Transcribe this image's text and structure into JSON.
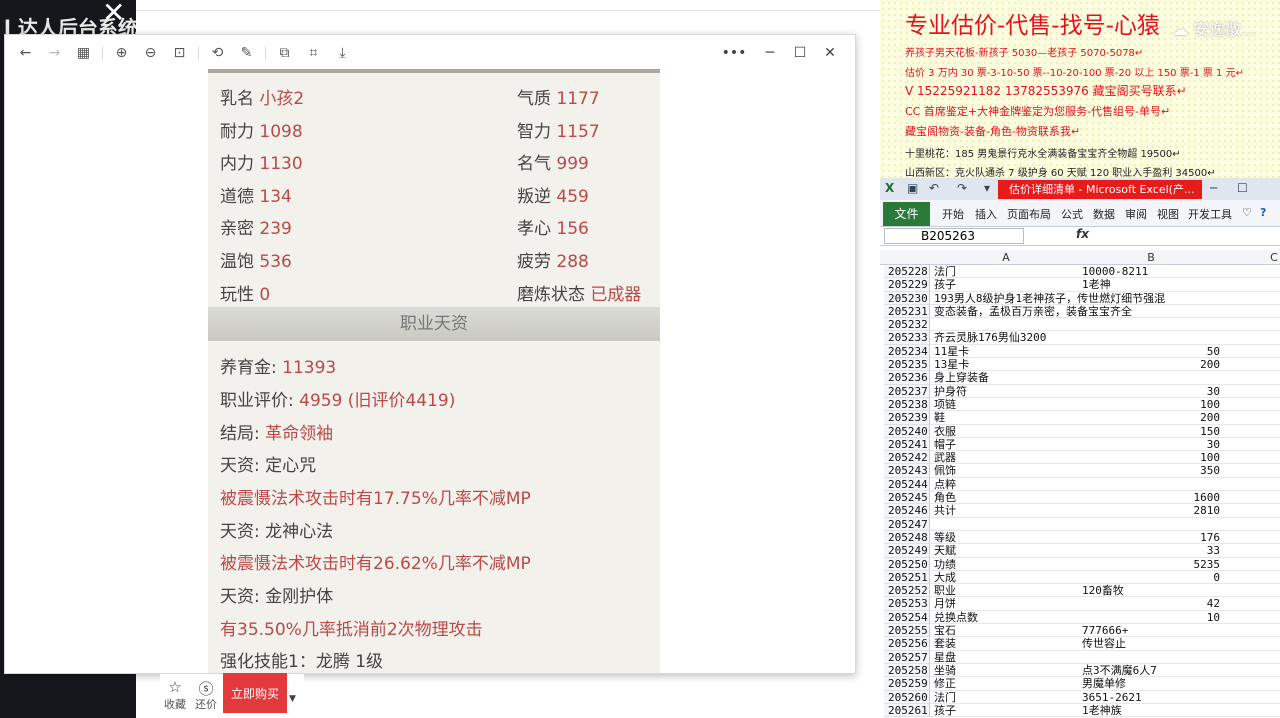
{
  "background": {
    "title_fragment": "l 达人后台系统"
  },
  "viewer": {
    "toolbar_icons": [
      "back-arrow-icon",
      "forward-arrow-icon",
      "grid-icon",
      "zoom-in-icon",
      "zoom-out-icon",
      "fit-width-icon",
      "rotate-icon",
      "edit-icon",
      "copy-icon",
      "crop-icon",
      "download-icon"
    ],
    "controls": {
      "more": "•••",
      "minimize": "─",
      "maximize": "☐",
      "close": "✕"
    },
    "stats": [
      {
        "l_label": "乳名",
        "l_value": "小孩2",
        "r_label": "气质",
        "r_value": "1177"
      },
      {
        "l_label": "耐力",
        "l_value": "1098",
        "r_label": "智力",
        "r_value": "1157"
      },
      {
        "l_label": "内力",
        "l_value": "1130",
        "r_label": "名气",
        "r_value": "999"
      },
      {
        "l_label": "道德",
        "l_value": "134",
        "r_label": "叛逆",
        "r_value": "459"
      },
      {
        "l_label": "亲密",
        "l_value": "239",
        "r_label": "孝心",
        "r_value": "156"
      },
      {
        "l_label": "温饱",
        "l_value": "536",
        "r_label": "疲劳",
        "r_value": "288"
      },
      {
        "l_label": "玩性",
        "l_value": "0",
        "r_label": "磨炼状态",
        "r_value": "已成器"
      }
    ],
    "section_title": "职业天资",
    "details": [
      {
        "label": "养育金: ",
        "value": "11393"
      },
      {
        "label": "职业评价: ",
        "value": "4959 (旧评价4419)"
      },
      {
        "label": "结局: ",
        "value": "革命领袖"
      },
      {
        "label": "天资: 定心咒",
        "value": ""
      },
      {
        "label": "",
        "value": "被震慑法术攻击时有17.75%几率不减MP"
      },
      {
        "label": "天资: 龙神心法",
        "value": ""
      },
      {
        "label": "",
        "value": "被震慑法术攻击时有26.62%几率不减MP"
      },
      {
        "label": "天资: 金刚护体",
        "value": ""
      },
      {
        "label": "",
        "value": "有35.50%几率抵消前2次物理攻击"
      },
      {
        "label": "强化技能1：龙腾 1级",
        "value": ""
      }
    ]
  },
  "bottom_bar": {
    "collect": "收藏",
    "bargain": "还价",
    "buy": "立即购买"
  },
  "ad": {
    "title": "专业估价-代售-找号-心猿",
    "watermark": "☁ 安逸散...",
    "lines": [
      "养孩子男天花板-新孩子 5030—老孩子 5070-5078↵",
      "估价 3 万内 30 票-3-10-50 票--10-20-100 票-20 以上 150 票-1 票 1 元↵",
      "V 15225921182      13782553976     藏宝阁买号联系↵",
      "CC 首席鉴定+大神金牌鉴定为您服务-代售组号-单号↵",
      "藏宝阁物资-装备-角色-物资联系我↵",
      "十里桃花：185 男鬼景行克水全满装备宝宝齐全物超 19500↵",
      "山西新区：克火队通杀 7 级护身 60 天赋 120 职业入手盈利 34500↵"
    ]
  },
  "excel": {
    "window_title": "估价详细清单 - Microsoft Excel(产...",
    "file_tab": "文件",
    "tabs": [
      "开始",
      "插入",
      "页面布局",
      "公式",
      "数据",
      "审阅",
      "视图",
      "开发工具"
    ],
    "name_box": "B205263",
    "fx": "fx",
    "col_headers": [
      "A",
      "B",
      "C"
    ],
    "rows": [
      {
        "n": "205228",
        "a": "法门",
        "b": "10000-8211",
        "num": false
      },
      {
        "n": "205229",
        "a": "孩子",
        "b": "1老神",
        "num": false
      },
      {
        "n": "205230",
        "a": "193男人8级护身1老神孩子，传世燃灯细节强混",
        "b": "",
        "num": false
      },
      {
        "n": "205231",
        "a": "变态装备，孟极百万亲密，装备宝宝齐全",
        "b": "",
        "num": false
      },
      {
        "n": "205232",
        "a": "",
        "b": "",
        "num": false
      },
      {
        "n": "205233",
        "a": "齐云灵脉176男仙3200",
        "b": "",
        "num": false
      },
      {
        "n": "205234",
        "a": "11星卡",
        "b": "50",
        "num": true
      },
      {
        "n": "205235",
        "a": "13星卡",
        "b": "200",
        "num": true
      },
      {
        "n": "205236",
        "a": "身上穿装备",
        "b": "",
        "num": false
      },
      {
        "n": "205237",
        "a": "护身符",
        "b": "30",
        "num": true
      },
      {
        "n": "205238",
        "a": "项链",
        "b": "100",
        "num": true
      },
      {
        "n": "205239",
        "a": "鞋",
        "b": "200",
        "num": true
      },
      {
        "n": "205240",
        "a": "衣服",
        "b": "150",
        "num": true
      },
      {
        "n": "205241",
        "a": "帽子",
        "b": "30",
        "num": true
      },
      {
        "n": "205242",
        "a": "武器",
        "b": "100",
        "num": true
      },
      {
        "n": "205243",
        "a": "佩饰",
        "b": "350",
        "num": true
      },
      {
        "n": "205244",
        "a": "点粹",
        "b": "",
        "num": false
      },
      {
        "n": "205245",
        "a": "角色",
        "b": "1600",
        "num": true
      },
      {
        "n": "205246",
        "a": "共计",
        "b": "2810",
        "num": true
      },
      {
        "n": "205247",
        "a": "",
        "b": "",
        "num": false
      },
      {
        "n": "205248",
        "a": "等级",
        "b": "176",
        "num": true
      },
      {
        "n": "205249",
        "a": "天赋",
        "b": "33",
        "num": true
      },
      {
        "n": "205250",
        "a": "功绩",
        "b": "5235",
        "num": true
      },
      {
        "n": "205251",
        "a": "大成",
        "b": "0",
        "num": true
      },
      {
        "n": "205252",
        "a": "职业",
        "b": "120畜牧",
        "num": false
      },
      {
        "n": "205253",
        "a": "月饼",
        "b": "42",
        "num": true
      },
      {
        "n": "205254",
        "a": "兑换点数",
        "b": "10",
        "num": true
      },
      {
        "n": "205255",
        "a": "宝石",
        "b": "777666+",
        "num": false
      },
      {
        "n": "205256",
        "a": "套装",
        "b": "传世容止",
        "num": false
      },
      {
        "n": "205257",
        "a": "星盘",
        "b": "",
        "num": false
      },
      {
        "n": "205258",
        "a": "坐骑",
        "b": "点3不满魔6人7",
        "num": false
      },
      {
        "n": "205259",
        "a": "修正",
        "b": "男魔单修",
        "num": false
      },
      {
        "n": "205260",
        "a": "法门",
        "b": "3651-2621",
        "num": false
      },
      {
        "n": "205261",
        "a": "孩子",
        "b": "1老神族",
        "num": false
      }
    ]
  },
  "colors": {
    "value_red": "#b94a48",
    "ad_red": "#e0141e",
    "excel_green": "#2b7a3a",
    "buy_red": "#e4393c"
  }
}
